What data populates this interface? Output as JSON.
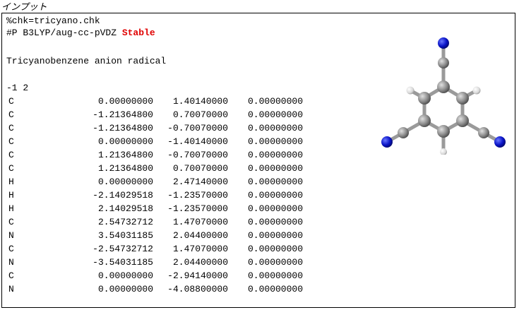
{
  "caption": "インプット",
  "input": {
    "chk_line": "%chk=tricyano.chk",
    "route_prefix": "#P B3LYP/aug-cc-pVDZ ",
    "route_keyword": "Stable",
    "title": "Tricyanobenzene anion radical",
    "charge_multiplicity": "-1 2",
    "atoms": [
      {
        "el": "C",
        "x": "0.00000000",
        "y": "1.40140000",
        "z": "0.00000000"
      },
      {
        "el": "C",
        "x": "-1.21364800",
        "y": "0.70070000",
        "z": "0.00000000"
      },
      {
        "el": "C",
        "x": "-1.21364800",
        "y": "-0.70070000",
        "z": "0.00000000"
      },
      {
        "el": "C",
        "x": "0.00000000",
        "y": "-1.40140000",
        "z": "0.00000000"
      },
      {
        "el": "C",
        "x": "1.21364800",
        "y": "-0.70070000",
        "z": "0.00000000"
      },
      {
        "el": "C",
        "x": "1.21364800",
        "y": "0.70070000",
        "z": "0.00000000"
      },
      {
        "el": "H",
        "x": "0.00000000",
        "y": "2.47140000",
        "z": "0.00000000"
      },
      {
        "el": "H",
        "x": "-2.14029518",
        "y": "-1.23570000",
        "z": "0.00000000"
      },
      {
        "el": "H",
        "x": "2.14029518",
        "y": "-1.23570000",
        "z": "0.00000000"
      },
      {
        "el": "C",
        "x": "2.54732712",
        "y": "1.47070000",
        "z": "0.00000000"
      },
      {
        "el": "N",
        "x": "3.54031185",
        "y": "2.04400000",
        "z": "0.00000000"
      },
      {
        "el": "C",
        "x": "-2.54732712",
        "y": "1.47070000",
        "z": "0.00000000"
      },
      {
        "el": "N",
        "x": "-3.54031185",
        "y": "2.04400000",
        "z": "0.00000000"
      },
      {
        "el": "C",
        "x": "0.00000000",
        "y": "-2.94140000",
        "z": "0.00000000"
      },
      {
        "el": "N",
        "x": "0.00000000",
        "y": "-4.08800000",
        "z": "0.00000000"
      }
    ]
  },
  "colors": {
    "keyword": "#e00000",
    "carbon": "#8c8c8c",
    "hydrogen": "#e6e6e6",
    "nitrogen": "#0a14c8"
  }
}
